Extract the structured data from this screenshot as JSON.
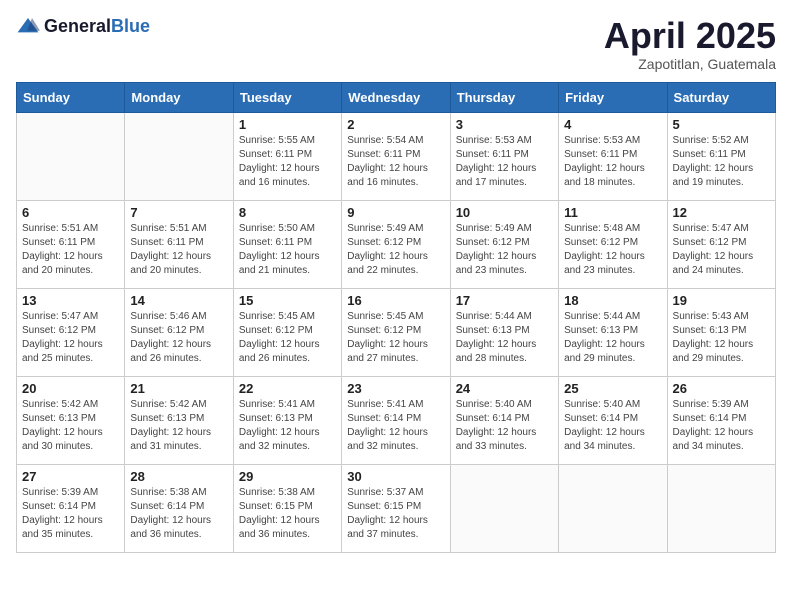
{
  "logo": {
    "general": "General",
    "blue": "Blue"
  },
  "header": {
    "month": "April 2025",
    "location": "Zapotitlan, Guatemala"
  },
  "weekdays": [
    "Sunday",
    "Monday",
    "Tuesday",
    "Wednesday",
    "Thursday",
    "Friday",
    "Saturday"
  ],
  "weeks": [
    [
      {
        "day": "",
        "info": ""
      },
      {
        "day": "",
        "info": ""
      },
      {
        "day": "1",
        "info": "Sunrise: 5:55 AM\nSunset: 6:11 PM\nDaylight: 12 hours and 16 minutes."
      },
      {
        "day": "2",
        "info": "Sunrise: 5:54 AM\nSunset: 6:11 PM\nDaylight: 12 hours and 16 minutes."
      },
      {
        "day": "3",
        "info": "Sunrise: 5:53 AM\nSunset: 6:11 PM\nDaylight: 12 hours and 17 minutes."
      },
      {
        "day": "4",
        "info": "Sunrise: 5:53 AM\nSunset: 6:11 PM\nDaylight: 12 hours and 18 minutes."
      },
      {
        "day": "5",
        "info": "Sunrise: 5:52 AM\nSunset: 6:11 PM\nDaylight: 12 hours and 19 minutes."
      }
    ],
    [
      {
        "day": "6",
        "info": "Sunrise: 5:51 AM\nSunset: 6:11 PM\nDaylight: 12 hours and 20 minutes."
      },
      {
        "day": "7",
        "info": "Sunrise: 5:51 AM\nSunset: 6:11 PM\nDaylight: 12 hours and 20 minutes."
      },
      {
        "day": "8",
        "info": "Sunrise: 5:50 AM\nSunset: 6:11 PM\nDaylight: 12 hours and 21 minutes."
      },
      {
        "day": "9",
        "info": "Sunrise: 5:49 AM\nSunset: 6:12 PM\nDaylight: 12 hours and 22 minutes."
      },
      {
        "day": "10",
        "info": "Sunrise: 5:49 AM\nSunset: 6:12 PM\nDaylight: 12 hours and 23 minutes."
      },
      {
        "day": "11",
        "info": "Sunrise: 5:48 AM\nSunset: 6:12 PM\nDaylight: 12 hours and 23 minutes."
      },
      {
        "day": "12",
        "info": "Sunrise: 5:47 AM\nSunset: 6:12 PM\nDaylight: 12 hours and 24 minutes."
      }
    ],
    [
      {
        "day": "13",
        "info": "Sunrise: 5:47 AM\nSunset: 6:12 PM\nDaylight: 12 hours and 25 minutes."
      },
      {
        "day": "14",
        "info": "Sunrise: 5:46 AM\nSunset: 6:12 PM\nDaylight: 12 hours and 26 minutes."
      },
      {
        "day": "15",
        "info": "Sunrise: 5:45 AM\nSunset: 6:12 PM\nDaylight: 12 hours and 26 minutes."
      },
      {
        "day": "16",
        "info": "Sunrise: 5:45 AM\nSunset: 6:12 PM\nDaylight: 12 hours and 27 minutes."
      },
      {
        "day": "17",
        "info": "Sunrise: 5:44 AM\nSunset: 6:13 PM\nDaylight: 12 hours and 28 minutes."
      },
      {
        "day": "18",
        "info": "Sunrise: 5:44 AM\nSunset: 6:13 PM\nDaylight: 12 hours and 29 minutes."
      },
      {
        "day": "19",
        "info": "Sunrise: 5:43 AM\nSunset: 6:13 PM\nDaylight: 12 hours and 29 minutes."
      }
    ],
    [
      {
        "day": "20",
        "info": "Sunrise: 5:42 AM\nSunset: 6:13 PM\nDaylight: 12 hours and 30 minutes."
      },
      {
        "day": "21",
        "info": "Sunrise: 5:42 AM\nSunset: 6:13 PM\nDaylight: 12 hours and 31 minutes."
      },
      {
        "day": "22",
        "info": "Sunrise: 5:41 AM\nSunset: 6:13 PM\nDaylight: 12 hours and 32 minutes."
      },
      {
        "day": "23",
        "info": "Sunrise: 5:41 AM\nSunset: 6:14 PM\nDaylight: 12 hours and 32 minutes."
      },
      {
        "day": "24",
        "info": "Sunrise: 5:40 AM\nSunset: 6:14 PM\nDaylight: 12 hours and 33 minutes."
      },
      {
        "day": "25",
        "info": "Sunrise: 5:40 AM\nSunset: 6:14 PM\nDaylight: 12 hours and 34 minutes."
      },
      {
        "day": "26",
        "info": "Sunrise: 5:39 AM\nSunset: 6:14 PM\nDaylight: 12 hours and 34 minutes."
      }
    ],
    [
      {
        "day": "27",
        "info": "Sunrise: 5:39 AM\nSunset: 6:14 PM\nDaylight: 12 hours and 35 minutes."
      },
      {
        "day": "28",
        "info": "Sunrise: 5:38 AM\nSunset: 6:14 PM\nDaylight: 12 hours and 36 minutes."
      },
      {
        "day": "29",
        "info": "Sunrise: 5:38 AM\nSunset: 6:15 PM\nDaylight: 12 hours and 36 minutes."
      },
      {
        "day": "30",
        "info": "Sunrise: 5:37 AM\nSunset: 6:15 PM\nDaylight: 12 hours and 37 minutes."
      },
      {
        "day": "",
        "info": ""
      },
      {
        "day": "",
        "info": ""
      },
      {
        "day": "",
        "info": ""
      }
    ]
  ]
}
